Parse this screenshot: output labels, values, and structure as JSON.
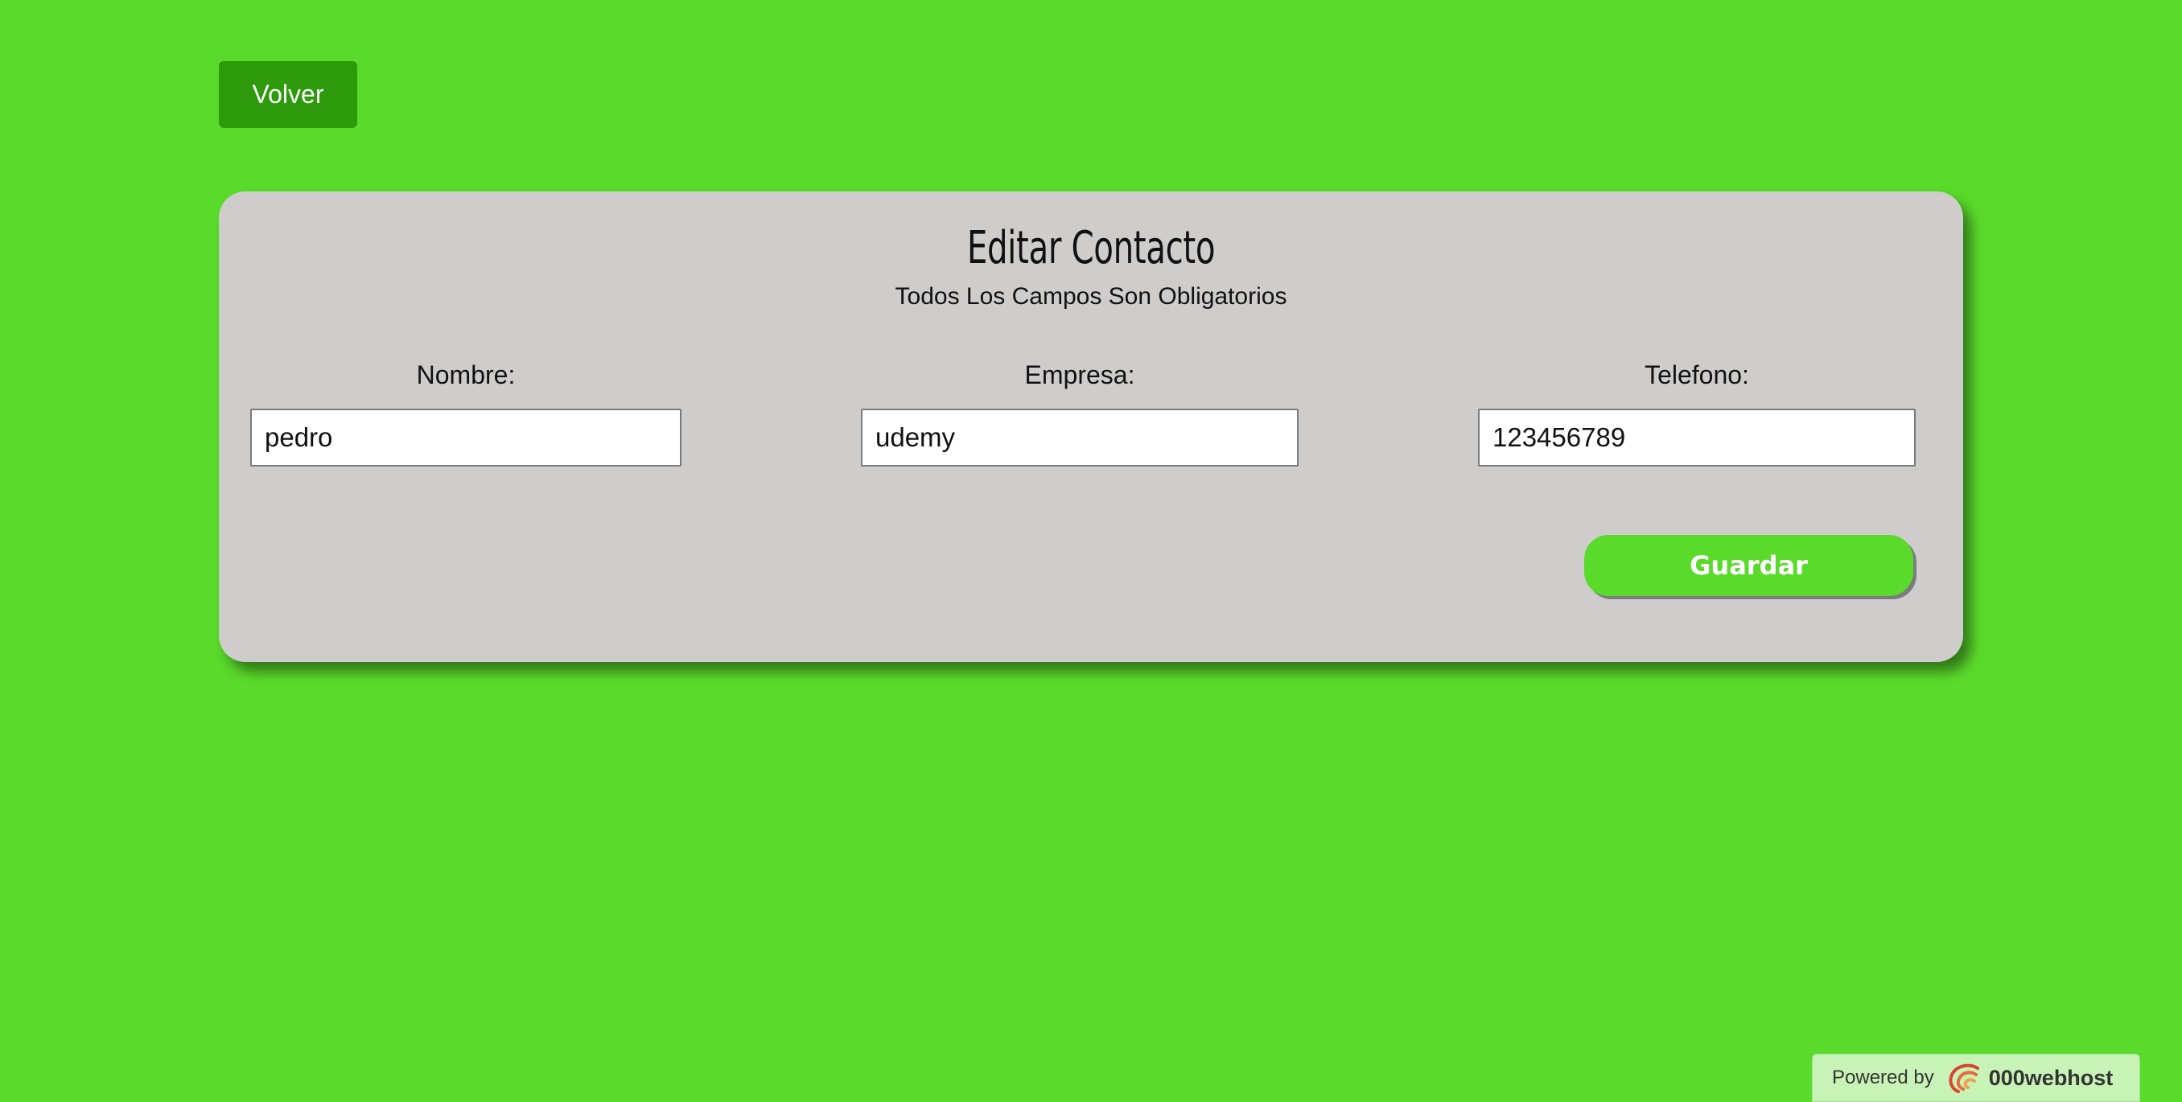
{
  "header": {
    "back_label": "Volver"
  },
  "form": {
    "title": "Editar Contacto",
    "subtitle": "Todos Los Campos Son Obligatorios",
    "fields": [
      {
        "label": "Nombre:",
        "value": "pedro"
      },
      {
        "label": "Empresa:",
        "value": "udemy"
      },
      {
        "label": "Telefono:",
        "value": "123456789"
      }
    ],
    "save_label": "Guardar"
  },
  "footer": {
    "powered_by": "Powered by",
    "brand": "000webhost",
    "brand_icon": "000webhost-logo-icon"
  },
  "colors": {
    "background": "#5adb2b",
    "back_button": "#2d9a0b",
    "card": "#cfcdcc",
    "save_button": "#5adb2b",
    "badge": "#c7f3b6"
  }
}
